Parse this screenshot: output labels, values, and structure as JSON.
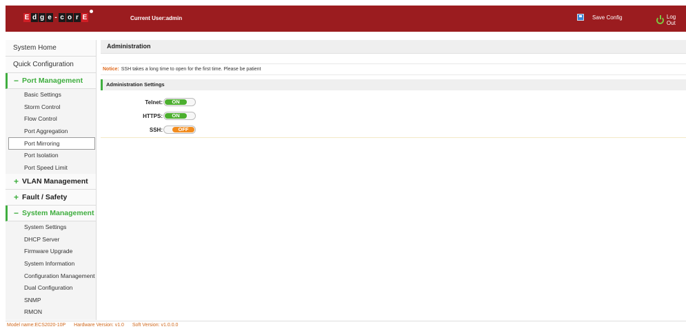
{
  "header": {
    "logo_letters": [
      "E",
      "d",
      "g",
      "e",
      "-",
      "c",
      "o",
      "r",
      "E"
    ],
    "current_user": "Current User:admin",
    "save_config": "Save Config",
    "logout": "Log Out"
  },
  "sidebar": {
    "system_home": "System Home",
    "quick_configuration": "Quick Configuration",
    "port_management": {
      "sign": "−",
      "label": "Port Management",
      "items": [
        "Basic Settings",
        "Storm Control",
        "Flow Control",
        "Port Aggregation",
        "Port Mirroring",
        "Port Isolation",
        "Port Speed Limit"
      ]
    },
    "vlan_management": {
      "sign": "+",
      "label": "VLAN Management"
    },
    "fault_safety": {
      "sign": "+",
      "label": "Fault / Safety"
    },
    "system_management": {
      "sign": "−",
      "label": "System Management",
      "items": [
        "System Settings",
        "DHCP Server",
        "Firmware Upgrade",
        "System Information",
        "Configuration Management",
        "Dual Configuration",
        "SNMP",
        "RMON"
      ]
    }
  },
  "main": {
    "title": "Administration",
    "notice_label": "Notice:",
    "notice_text": "SSH takes a long time to open for the first time. Please be patient",
    "section_title": "Administration Settings",
    "settings": [
      {
        "label": "Telnet:",
        "state": "ON"
      },
      {
        "label": "HTTPS:",
        "state": "ON"
      },
      {
        "label": "SSH:",
        "state": "OFF"
      }
    ]
  },
  "footer": {
    "model": "Model name:ECS2020-10P",
    "hardware": "Hardware Version: v1.0",
    "software": "Soft Version: v1.0.0.0"
  },
  "colors": {
    "header_bg": "#9b1c1f",
    "accent_green": "#3fae3f",
    "toggle_on": "#4caf2f",
    "toggle_off": "#f28c1e",
    "notice_label": "#e06a1e",
    "footer_text": "#d0681c"
  }
}
